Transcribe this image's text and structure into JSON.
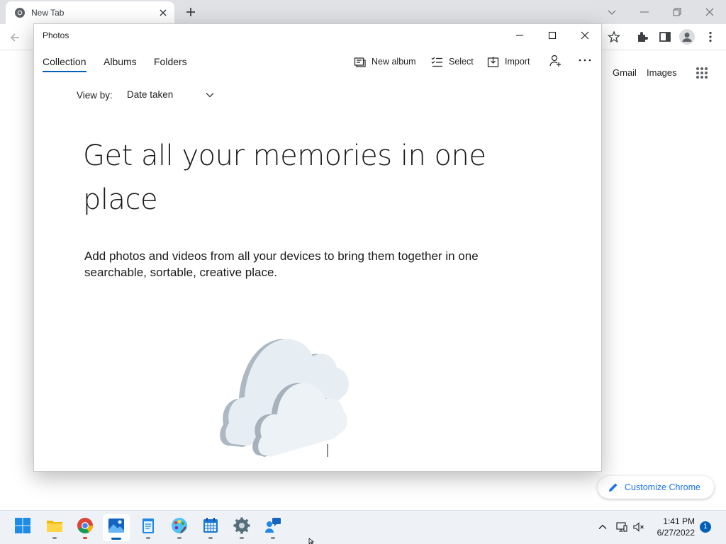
{
  "chrome": {
    "tab_title": "New Tab",
    "links": {
      "gmail": "Gmail",
      "images": "Images"
    },
    "customize_label": "Customize Chrome"
  },
  "photos": {
    "window_title": "Photos",
    "nav": {
      "collection": "Collection",
      "albums": "Albums",
      "folders": "Folders"
    },
    "commands": {
      "new_album": "New album",
      "select": "Select",
      "import": "Import"
    },
    "view_by_label": "View by:",
    "view_by_value": "Date taken",
    "heading": "Get all your memories in one place",
    "description": "Add photos and videos from all your devices to bring them together in one searchable, sortable, creative place."
  },
  "taskbar": {
    "time": "1:41 PM",
    "date": "6/27/2022",
    "notification_count": "1"
  },
  "colors": {
    "accent": "#005fb8",
    "chrome_link": "#1a73e8"
  }
}
